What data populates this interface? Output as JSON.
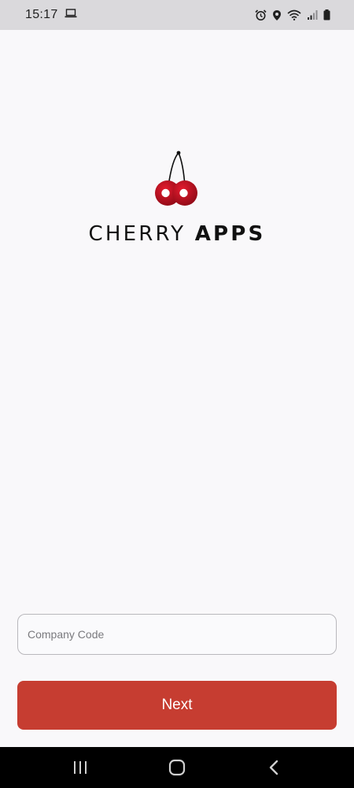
{
  "status_bar": {
    "time": "15:17",
    "icons": [
      "laptop-icon",
      "alarm-icon",
      "location-icon",
      "wifi-icon",
      "signal-icon",
      "battery-icon"
    ]
  },
  "logo": {
    "icon": "cherry-icon",
    "text_light": "CHERRY",
    "text_bold": "APPS",
    "color": "#c8102e"
  },
  "form": {
    "company_code_placeholder": "Company Code",
    "company_code_value": "",
    "next_label": "Next",
    "next_color": "#c63d31"
  },
  "nav_bar": {
    "icons": [
      "recent-apps-icon",
      "home-icon",
      "back-icon"
    ]
  }
}
